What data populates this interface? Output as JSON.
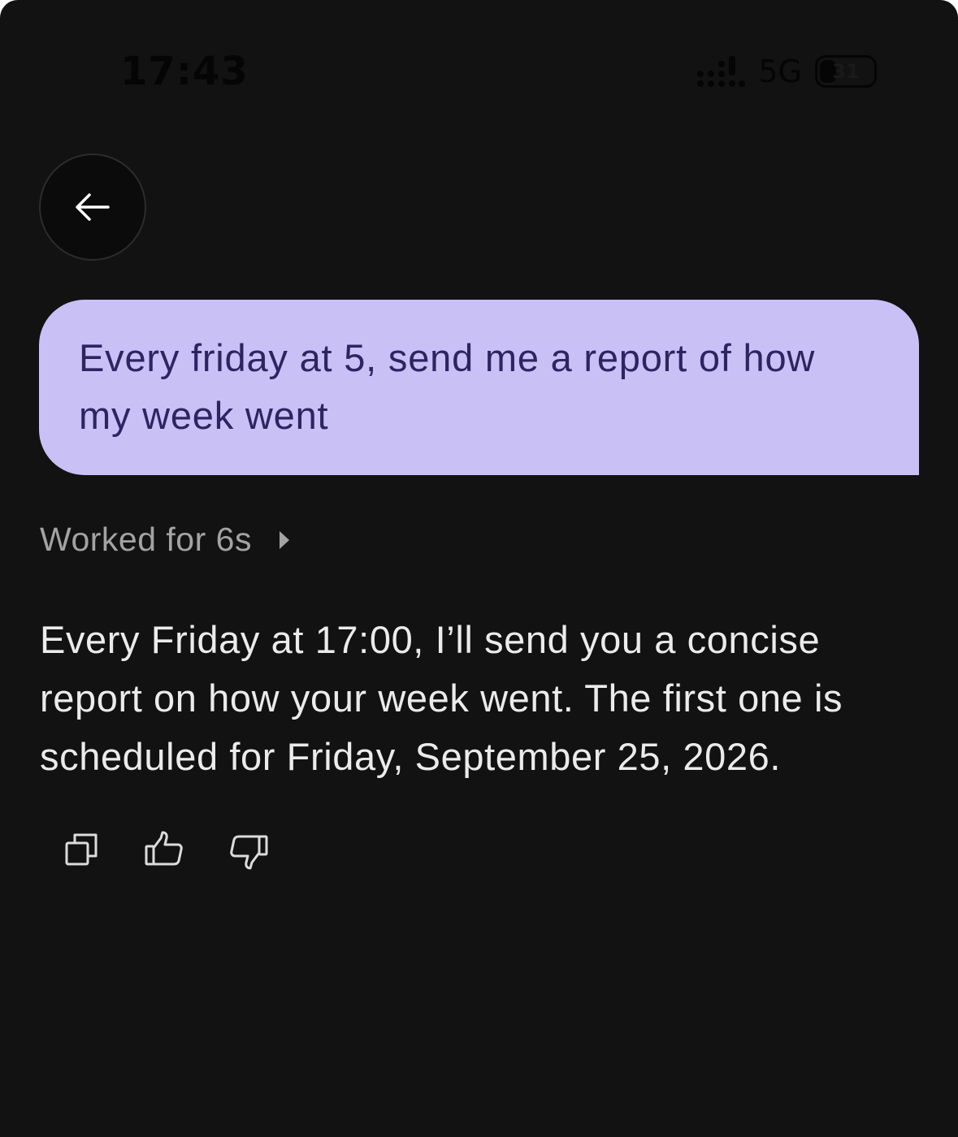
{
  "status_bar": {
    "time": "17:43",
    "network": "5G",
    "battery_level": "31",
    "battery_fraction": 0.31,
    "signal_icon": "signal-bars-icon"
  },
  "nav": {
    "back_icon": "arrow-left-icon"
  },
  "conversation": {
    "user_message": "Every friday at 5, send me a report of how my week went",
    "worked_label": "Worked for 6s",
    "assistant_message": "Every Friday at 17:00, I’ll send you a concise report on how your week went. The first one is scheduled for Friday, September 25, 2026."
  },
  "actions": [
    {
      "name": "copy",
      "icon": "copy-icon"
    },
    {
      "name": "thumbs-up",
      "icon": "thumbs-up-icon"
    },
    {
      "name": "thumbs-down",
      "icon": "thumbs-down-icon"
    }
  ],
  "colors": {
    "background": "#121212",
    "user_bubble": "#c9c0f6",
    "user_text": "#2d2461",
    "assistant_text": "#ebebeb",
    "muted_text": "#a3a3a3"
  }
}
